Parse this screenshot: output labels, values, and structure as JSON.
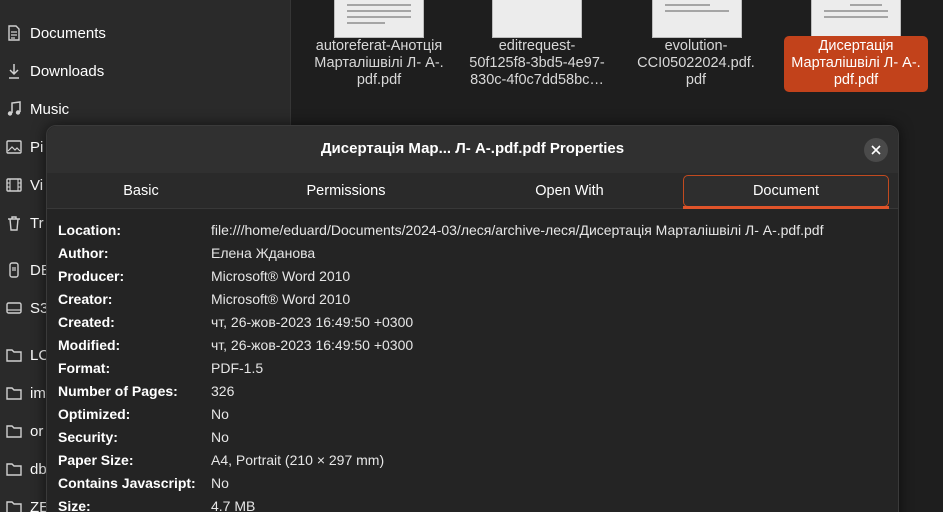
{
  "sidebar": {
    "items": [
      {
        "label": "Documents",
        "icon": "document-icon"
      },
      {
        "label": "Downloads",
        "icon": "download-icon"
      },
      {
        "label": "Music",
        "icon": "music-icon"
      },
      {
        "label": "Pi",
        "icon": "picture-icon"
      },
      {
        "label": "Vi",
        "icon": "video-icon"
      },
      {
        "label": "Tr",
        "icon": "trash-icon"
      },
      {
        "label": "DE",
        "icon": "drive-icon"
      },
      {
        "label": "S3",
        "icon": "drive-icon"
      },
      {
        "label": "LC",
        "icon": "folder-icon"
      },
      {
        "label": "im",
        "icon": "folder-icon"
      },
      {
        "label": "or",
        "icon": "folder-icon"
      },
      {
        "label": "db",
        "icon": "folder-icon"
      },
      {
        "label": "ZE",
        "icon": "folder-icon"
      }
    ]
  },
  "files": [
    {
      "line1": "autoreferat-Анотція",
      "line2": "Марталішвілі Л- А-.",
      "line3": "pdf.pdf",
      "selected": false
    },
    {
      "line1": "editrequest-",
      "line2": "50f125f8-3bd5-4e97-",
      "line3": "830c-4f0c7dd58bc…",
      "selected": false
    },
    {
      "line1": "evolution-",
      "line2": "CCI05022024.pdf.",
      "line3": "pdf",
      "selected": false
    },
    {
      "line1": "Дисертація",
      "line2": "Марталішвілі  Л- А-.",
      "line3": "pdf.pdf",
      "selected": true
    }
  ],
  "dialog": {
    "title": "Дисертація Мар...  Л- А-.pdf.pdf Properties",
    "close_icon": "close-icon",
    "tabs": [
      "Basic",
      "Permissions",
      "Open With",
      "Document"
    ],
    "active_tab": "Document",
    "properties": [
      {
        "key": "Location:",
        "value": "file:///home/eduard/Documents/2024-03/леся/archive-леся/Дисертація Марталішвілі Л- А-.pdf.pdf"
      },
      {
        "key": "Author:",
        "value": "Елена Жданова"
      },
      {
        "key": "Producer:",
        "value": "Microsoft® Word 2010"
      },
      {
        "key": "Creator:",
        "value": "Microsoft® Word 2010"
      },
      {
        "key": "Created:",
        "value": "чт, 26-жов-2023 16:49:50 +0300"
      },
      {
        "key": "Modified:",
        "value": "чт, 26-жов-2023 16:49:50 +0300"
      },
      {
        "key": "Format:",
        "value": "PDF-1.5"
      },
      {
        "key": "Number of Pages:",
        "value": "326"
      },
      {
        "key": "Optimized:",
        "value": "No"
      },
      {
        "key": "Security:",
        "value": "No"
      },
      {
        "key": "Paper Size:",
        "value": "A4, Portrait (210 × 297 mm)"
      },
      {
        "key": "Contains Javascript:",
        "value": "No"
      },
      {
        "key": "Size:",
        "value": "4.7 MB"
      }
    ]
  },
  "colors": {
    "accent": "#e0542a",
    "selection": "#c2421b",
    "background": "#1e1e1e",
    "dialog": "#242424"
  }
}
